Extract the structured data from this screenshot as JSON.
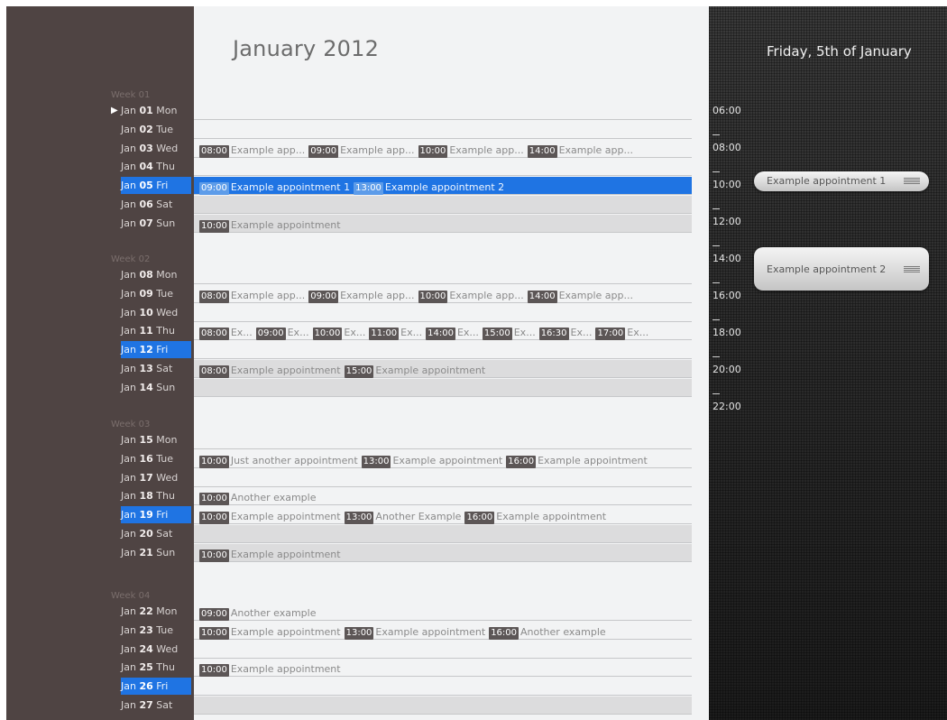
{
  "header": {
    "month_title": "January 2012",
    "selected_date": "Friday, 5th of January"
  },
  "weeks": [
    {
      "label": "Week 01",
      "days": [
        {
          "label": "Jan 01 Mon",
          "appointments": []
        },
        {
          "label": "Jan 02 Tue",
          "appointments": []
        },
        {
          "label": "Jan 03 Wed",
          "appointments": [
            {
              "time": "08:00",
              "title": "Example app..."
            },
            {
              "time": "09:00",
              "title": "Example app..."
            },
            {
              "time": "10:00",
              "title": "Example app..."
            },
            {
              "time": "14:00",
              "title": "Example app..."
            }
          ]
        },
        {
          "label": "Jan 04 Thu",
          "appointments": []
        },
        {
          "label": "Jan 05 Fri",
          "appointments": [
            {
              "time": "09:00",
              "title": "Example appointment 1"
            },
            {
              "time": "13:00",
              "title": "Example appointment 2"
            }
          ]
        },
        {
          "label": "Jan 06 Sat",
          "appointments": []
        },
        {
          "label": "Jan 07 Sun",
          "appointments": [
            {
              "time": "10:00",
              "title": "Example appointment"
            }
          ]
        }
      ]
    },
    {
      "label": "Week 02",
      "days": [
        {
          "label": "Jan 08 Mon",
          "appointments": []
        },
        {
          "label": "Jan 09 Tue",
          "appointments": [
            {
              "time": "08:00",
              "title": "Example app..."
            },
            {
              "time": "09:00",
              "title": "Example app..."
            },
            {
              "time": "10:00",
              "title": "Example app..."
            },
            {
              "time": "14:00",
              "title": "Example app..."
            }
          ]
        },
        {
          "label": "Jan 10 Wed",
          "appointments": []
        },
        {
          "label": "Jan 11 Thu",
          "appointments": [
            {
              "time": "08:00",
              "title": "Ex..."
            },
            {
              "time": "09:00",
              "title": "Ex..."
            },
            {
              "time": "10:00",
              "title": "Ex..."
            },
            {
              "time": "11:00",
              "title": "Ex..."
            },
            {
              "time": "14:00",
              "title": "Ex..."
            },
            {
              "time": "15:00",
              "title": "Ex..."
            },
            {
              "time": "16:30",
              "title": "Ex..."
            },
            {
              "time": "17:00",
              "title": "Ex..."
            }
          ]
        },
        {
          "label": "Jan 12 Fri",
          "appointments": []
        },
        {
          "label": "Jan 13 Sat",
          "appointments": [
            {
              "time": "08:00",
              "title": "Example appointment"
            },
            {
              "time": "15:00",
              "title": "Example appointment"
            }
          ]
        },
        {
          "label": "Jan 14 Sun",
          "appointments": []
        }
      ]
    },
    {
      "label": "Week 03",
      "days": [
        {
          "label": "Jan 15 Mon",
          "appointments": []
        },
        {
          "label": "Jan 16 Tue",
          "appointments": [
            {
              "time": "10:00",
              "title": "Just another appointment"
            },
            {
              "time": "13:00",
              "title": "Example appointment"
            },
            {
              "time": "16:00",
              "title": "Example appointment"
            }
          ]
        },
        {
          "label": "Jan 17 Wed",
          "appointments": []
        },
        {
          "label": "Jan 18 Thu",
          "appointments": [
            {
              "time": "10:00",
              "title": "Another example"
            }
          ]
        },
        {
          "label": "Jan 19 Fri",
          "appointments": [
            {
              "time": "10:00",
              "title": "Example appointment"
            },
            {
              "time": "13:00",
              "title": "Another Example"
            },
            {
              "time": "16:00",
              "title": "Example appointment"
            }
          ]
        },
        {
          "label": "Jan 20 Sat",
          "appointments": []
        },
        {
          "label": "Jan 21 Sun",
          "appointments": [
            {
              "time": "10:00",
              "title": "Example appointment"
            }
          ]
        }
      ]
    },
    {
      "label": "Week 04",
      "days": [
        {
          "label": "Jan 22 Mon",
          "appointments": [
            {
              "time": "09:00",
              "title": "Another example"
            }
          ]
        },
        {
          "label": "Jan 23 Tue",
          "appointments": [
            {
              "time": "10:00",
              "title": "Example appointment"
            },
            {
              "time": "13:00",
              "title": "Example appointment"
            },
            {
              "time": "16:00",
              "title": "Another example"
            }
          ]
        },
        {
          "label": "Jan 24 Wed",
          "appointments": []
        },
        {
          "label": "Jan 25 Thu",
          "appointments": [
            {
              "time": "10:00",
              "title": "Example appointment"
            }
          ]
        },
        {
          "label": "Jan 26 Fri",
          "appointments": []
        },
        {
          "label": "Jan 27 Sat",
          "appointments": []
        }
      ]
    }
  ],
  "day_detail": {
    "hours": [
      "06:00",
      "08:00",
      "10:00",
      "12:00",
      "14:00",
      "16:00",
      "18:00",
      "20:00",
      "22:00"
    ],
    "appointments": [
      {
        "title": "Example appointment 1"
      },
      {
        "title": "Example appointment 2"
      }
    ]
  },
  "colors": {
    "selected_blue": "#1f74e3",
    "sidebar_brown": "#4f4443",
    "time_badge": "#5c5656"
  }
}
